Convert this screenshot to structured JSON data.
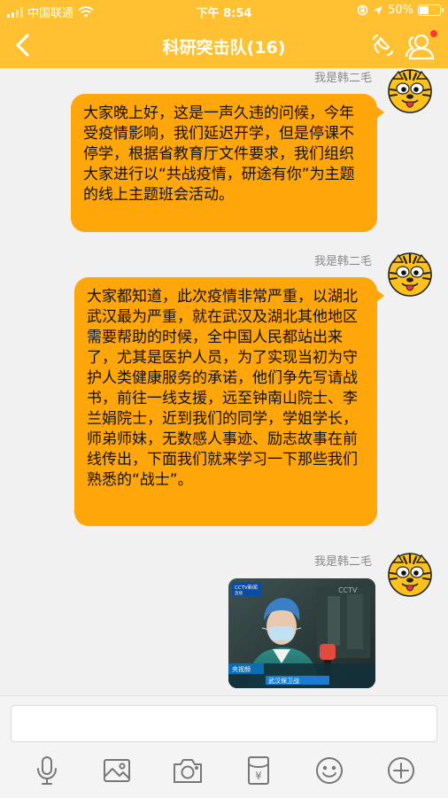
{
  "status_bar": {
    "carrier": "中国联通",
    "time": "下午 8:54",
    "battery_percent": "50%",
    "battery_level": 0.5
  },
  "nav": {
    "title": "科研突击队(16)",
    "back_icon": "chevron-left-icon",
    "hand_icon": "hand-wave-icon",
    "group_icon": "group-members-icon",
    "has_notification": true
  },
  "messages": [
    {
      "sender": "我是韩二毛",
      "type": "text",
      "text": "大家晚上好，这是一声久违的问候，今年受疫情影响，我们延迟开学，但是停课不停学，根据省教育厅文件要求，我们组织大家进行以“共战疫情，研途有你”为主题的线上主题班会活动。"
    },
    {
      "sender": "我是韩二毛",
      "type": "text",
      "text": "大家都知道，此次疫情非常严重，以湖北武汉最为严重，就在武汉及湖北其他地区需要帮助的时候，全中国人民都站出来了，尤其是医护人员，为了实现当初为守护人类健康服务的承诺，他们争先写请战书，前往一线支援，远至钟南山院士、李兰娟院士，近到我们的同学，学姐学长，师弟师妹，无数感人事迹、励志故事在前线传出，下面我们就来学习一下那些我们熟悉的“战士”。"
    },
    {
      "sender": "我是韩二毛",
      "type": "image",
      "image_text": {
        "channel_logo": "CCTV新闻",
        "channel_sub": "直播",
        "corner_logo": "CCTV",
        "caption": "武汉保卫战",
        "lower_tag": "央视频"
      }
    }
  ],
  "input": {
    "placeholder": ""
  },
  "toolbar": [
    {
      "icon": "microphone-icon",
      "name": "voice-button"
    },
    {
      "icon": "image-icon",
      "name": "photo-button"
    },
    {
      "icon": "camera-icon",
      "name": "camera-button"
    },
    {
      "icon": "red-packet-icon",
      "name": "red-packet-button",
      "glyph": "¥"
    },
    {
      "icon": "emoji-icon",
      "name": "emoji-button"
    },
    {
      "icon": "plus-circle-icon",
      "name": "more-button"
    }
  ],
  "colors": {
    "header": "#ffc132",
    "bubble": "#ffa60a",
    "chat_bg": "#f1f1f1",
    "toolbar_icon": "#777777",
    "badge": "#ff3b30"
  }
}
